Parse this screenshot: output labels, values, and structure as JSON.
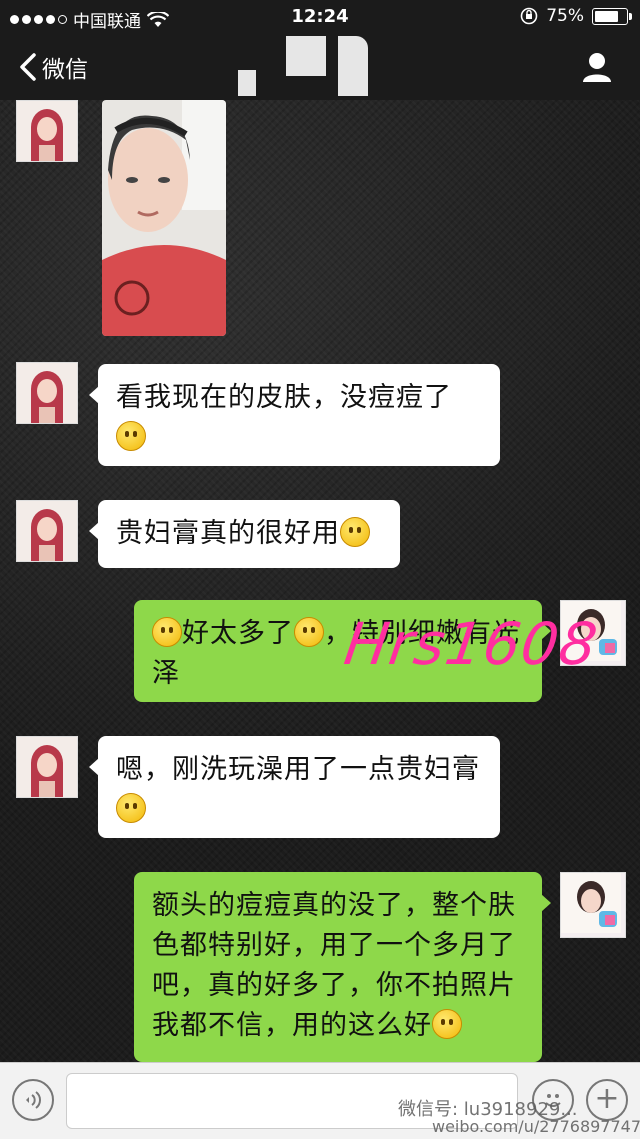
{
  "status_bar": {
    "carrier": "中国联通",
    "time": "12:24",
    "battery": "75%",
    "battery_level": 0.75
  },
  "nav": {
    "back_label": "微信"
  },
  "messages": [
    {
      "side": "in",
      "type": "image"
    },
    {
      "side": "in",
      "text": "看我现在的皮肤，没痘痘了",
      "emoji": "smile"
    },
    {
      "side": "in",
      "text": "贵妇膏真的很好用",
      "emoji": "smile"
    },
    {
      "side": "out",
      "text_a": "好太多了",
      "text_b": "，特别细嫩有光泽"
    },
    {
      "side": "in",
      "text": "嗯，刚洗玩澡用了一点贵妇膏",
      "emoji": "wink"
    },
    {
      "side": "out",
      "text": "额头的痘痘真的没了，整个肤色都特别好，用了一个多月了吧，真的好多了，你不拍照片我都不信，用的这么好",
      "emoji": "smile"
    }
  ],
  "watermark": "Hrs1608",
  "footer_watermark": {
    "line1": "微信号: lu3918929...",
    "line2": "weibo.com/u/2776897747"
  },
  "colors": {
    "out_bubble": "#8ed84a",
    "in_bubble": "#ffffff",
    "watermark": "#ff2ea0"
  }
}
